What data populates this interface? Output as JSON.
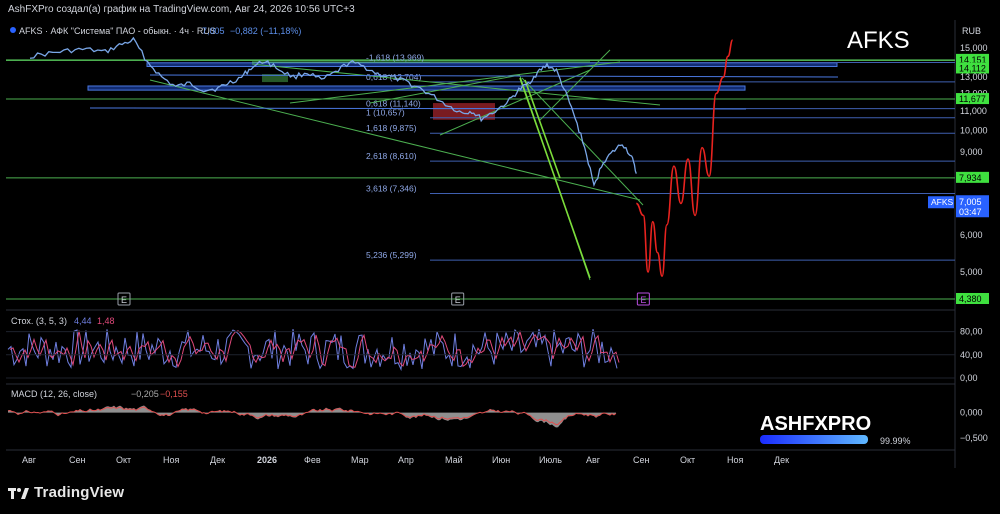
{
  "header": {
    "publisher_line": "AshFXPro создал(а) график на TradingView.com, Авг 24, 2026 10:56 UTC+3",
    "symbol_line_prefix": "AFKS · АФК \"Система\" ПАО - обыкн. · 4ч · RUS",
    "symbol_line_price": "7,005",
    "symbol_line_change": "−0,882 (−11,18%)",
    "ticker_watermark": "AFKS",
    "currency": "RUB"
  },
  "brand": {
    "name": "ASHFXPRO",
    "meter_label": "99.99%",
    "footer_logo_text": "TradingView"
  },
  "colors": {
    "background": "#000000",
    "price_line": "#7aa7e8",
    "forecast": "#e8231f",
    "level_green": "#4caf50",
    "level_blue": "#3f5fb0",
    "stoch_k": "#6f7fe0",
    "stoch_d": "#e0497a",
    "macd_line": "#e05050",
    "macd_hist": "#a8a8a8",
    "green_label": "#3fe03f",
    "blue_label": "#2962ff"
  },
  "chart_data": [
    {
      "type": "line",
      "title": "AFKS",
      "ylabel": "RUB",
      "scale": "log",
      "ylim": [
        4.4,
        16.0
      ],
      "x_axis_months": [
        "Авг",
        "Сен",
        "Окт",
        "Ноя",
        "Дек",
        "2026",
        "Фев",
        "Мар",
        "Апр",
        "Май",
        "Июн",
        "Июль",
        "Авг",
        "Сен",
        "Окт",
        "Ноя",
        "Дек"
      ],
      "y_ticks": [
        "15,000",
        "14,000",
        "13,000",
        "12,000",
        "11,000",
        "10,000",
        "9,000",
        "8,000",
        "7,000",
        "6,000",
        "5,000"
      ],
      "y_tick_values": [
        15,
        14,
        13,
        12,
        11,
        10,
        9,
        8,
        7,
        6,
        5
      ],
      "series": [
        {
          "role": "price",
          "x": [
            0,
            0.4,
            0.8,
            1.2,
            1.6,
            1.9,
            2.2,
            2.5,
            2.8,
            3.1,
            3.4,
            3.7,
            4.0,
            4.2,
            4.5,
            4.7,
            5.0,
            5.3,
            5.6,
            5.9,
            6.2,
            6.5,
            6.8,
            7.1,
            7.4,
            7.7,
            8.0,
            8.3,
            8.6,
            8.9,
            9.2,
            9.4,
            9.6,
            9.9,
            10.2,
            10.4,
            10.6,
            10.8,
            11.0,
            11.2,
            11.4,
            11.6,
            11.8,
            12.0,
            12.2,
            12.4,
            12.6,
            12.8,
            12.9
          ],
          "y": [
            14.4,
            14.6,
            14.8,
            14.9,
            14.7,
            15.2,
            15.6,
            14.0,
            13.0,
            12.4,
            12.6,
            12.2,
            12.3,
            12.6,
            13.0,
            13.6,
            14.1,
            13.5,
            13.0,
            13.3,
            12.8,
            13.3,
            14.0,
            13.7,
            13.2,
            13.0,
            12.7,
            12.3,
            11.8,
            11.3,
            10.9,
            11.0,
            10.6,
            11.0,
            11.6,
            12.2,
            12.6,
            13.3,
            13.8,
            13.4,
            12.0,
            10.6,
            9.2,
            7.6,
            8.6,
            9.0,
            9.4,
            8.8,
            8.1
          ]
        },
        {
          "role": "forecast",
          "x": [
            12.9,
            13.05,
            13.15,
            13.25,
            13.35,
            13.45,
            13.55,
            13.7,
            13.85,
            14.0,
            14.15,
            14.3,
            14.45,
            14.6,
            14.75,
            14.85,
            14.95
          ],
          "y": [
            7.0,
            6.6,
            5.0,
            6.4,
            5.5,
            4.9,
            6.3,
            8.4,
            7.0,
            8.7,
            6.6,
            9.2,
            8.0,
            12.0,
            13.0,
            14.4,
            15.6
          ]
        }
      ],
      "fib_levels": [
        {
          "label": "-1,618 (13,969)",
          "value": 13.969
        },
        {
          "label": "0,618 (12,704)",
          "value": 12.704
        },
        {
          "label": "0,618 (11,140)",
          "value": 11.14
        },
        {
          "label": "1 (10,657)",
          "value": 10.657
        },
        {
          "label": "1,618 (9,875)",
          "value": 9.875
        },
        {
          "label": "2,618 (8,610)",
          "value": 8.61
        },
        {
          "label": "3,618 (7,346)",
          "value": 7.346
        },
        {
          "label": "5,236 (5,299)",
          "value": 5.299
        }
      ],
      "horizontal_levels": [
        {
          "label": "14,151",
          "value": 14.151,
          "color": "green"
        },
        {
          "label": "14,112",
          "value": 14.112,
          "color": "green"
        },
        {
          "label": "11,677",
          "value": 11.677,
          "color": "green"
        },
        {
          "label": "7,934",
          "value": 7.934,
          "color": "green"
        },
        {
          "label": "4,380",
          "value": 4.38,
          "color": "green"
        }
      ],
      "last_price": {
        "ticker": "AFKS",
        "value": "7,005",
        "countdown": "03:47"
      },
      "event_markers": [
        {
          "label": "E",
          "x": 2
        },
        {
          "label": "E",
          "x": 9.1
        },
        {
          "label": "E",
          "x": 13.05
        }
      ]
    },
    {
      "type": "line",
      "title": "Стох. (3, 5, 3)",
      "legend_values": [
        "4,44",
        "1,48"
      ],
      "ylim": [
        0,
        100
      ],
      "y_ticks": [
        "80,00",
        "40,00",
        "0,00"
      ],
      "y_tick_values": [
        80,
        40,
        0
      ]
    },
    {
      "type": "line",
      "title": "MACD (12, 26, close)",
      "legend_values": [
        "−0,205",
        "−0,155"
      ],
      "ylim": [
        -0.7,
        0.25
      ],
      "y_ticks": [
        "0,000",
        "−0,500"
      ],
      "y_tick_values": [
        0,
        -0.5
      ]
    }
  ]
}
